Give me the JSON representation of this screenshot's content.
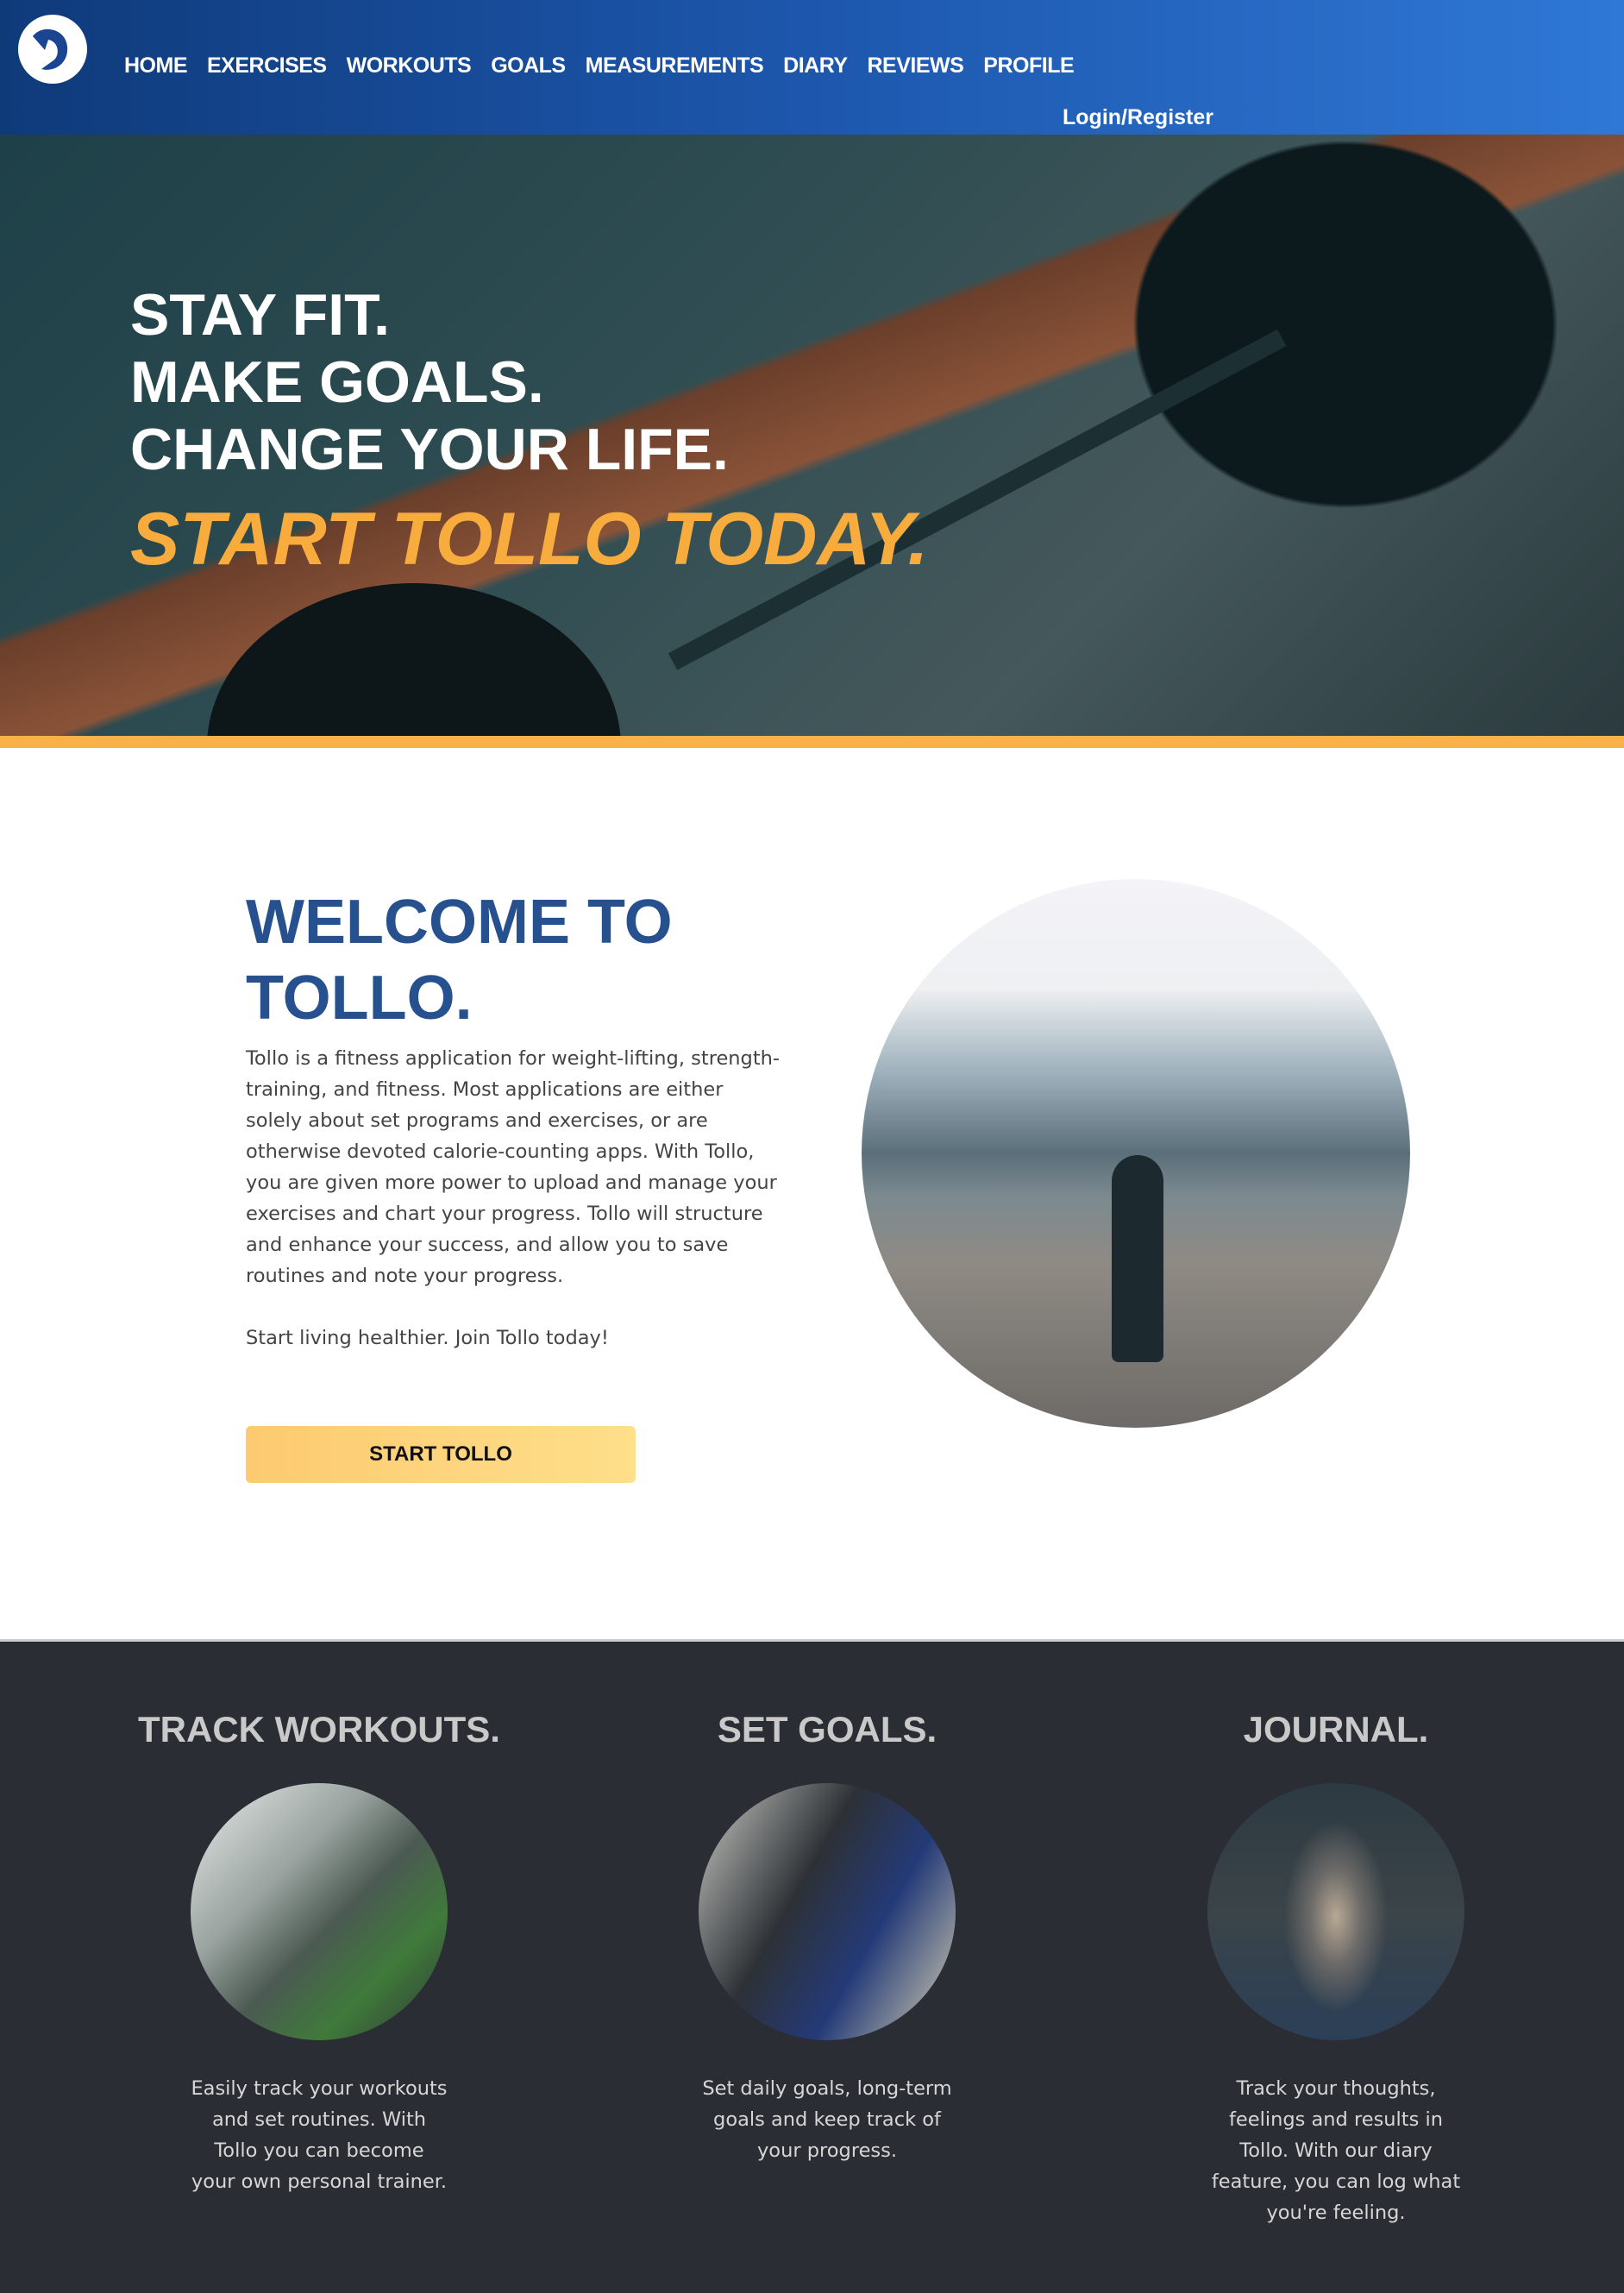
{
  "header": {
    "nav": [
      "HOME",
      "EXERCISES",
      "WORKOUTS",
      "GOALS",
      "MEASUREMENTS",
      "DIARY",
      "REVIEWS",
      "PROFILE"
    ],
    "login": "Login/Register"
  },
  "hero": {
    "lines": [
      "STAY FIT.",
      "MAKE GOALS.",
      "CHANGE YOUR LIFE."
    ],
    "cta": "START TOLLO TODAY."
  },
  "welcome": {
    "title_line1": "WELCOME TO",
    "title_line2": "TOLLO.",
    "body": "Tollo is a fitness application for weight-lifting, strength-training, and fitness. Most applications are either solely about set programs and exercises, or are otherwise devoted calorie-counting apps. With Tollo, you are given more power to upload and manage your exercises and chart your progress. Tollo will structure and enhance your success, and allow you to save routines and note your progress.",
    "join": "Start living healthier. Join Tollo today!",
    "button": "START TOLLO"
  },
  "features": [
    {
      "title": "TRACK WORKOUTS.",
      "text": "Easily track your workouts and set routines. With Tollo you can become your own personal trainer."
    },
    {
      "title": "SET GOALS.",
      "text": "Set daily goals, long-term goals and keep track of your progress."
    },
    {
      "title": "JOURNAL.",
      "text": "Track your thoughts, feelings and results in Tollo. With our diary feature, you can log what you're feeling."
    }
  ],
  "colors": {
    "brand_blue": "#26508e",
    "accent_orange": "#f8ac3d",
    "dark_bg": "#2a2d33"
  }
}
